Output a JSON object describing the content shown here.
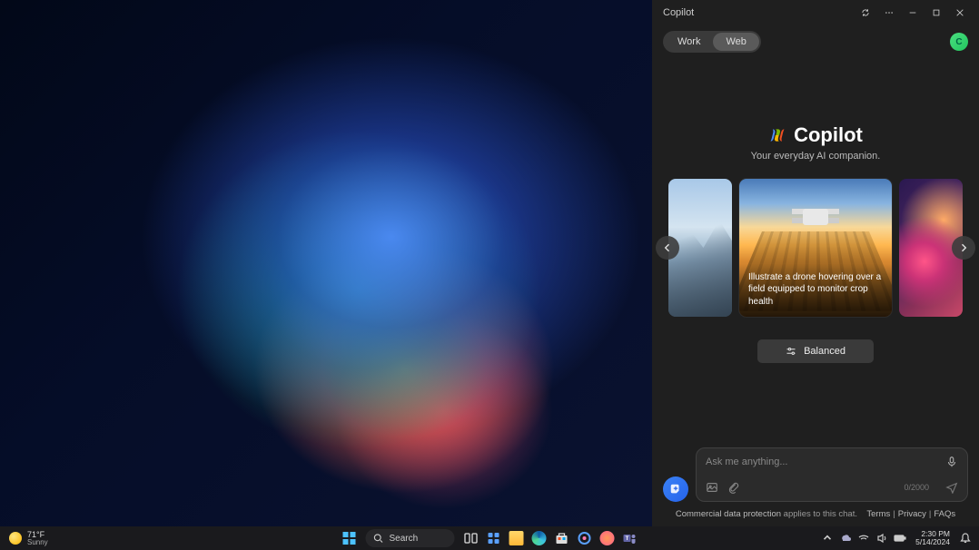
{
  "window": {
    "title": "Copilot"
  },
  "modes": {
    "work": "Work",
    "web": "Web",
    "active": "web"
  },
  "avatar_initial": "C",
  "hero": {
    "title": "Copilot",
    "subtitle": "Your everyday AI companion."
  },
  "carousel": {
    "main_caption": "Illustrate a drone hovering over a field equipped to monitor crop health"
  },
  "style_button": "Balanced",
  "chat": {
    "placeholder": "Ask me anything...",
    "char_count": "0/2000"
  },
  "footer": {
    "protection_link": "Commercial data protection",
    "protection_suffix": " applies to this chat.",
    "terms": "Terms",
    "privacy": "Privacy",
    "faqs": "FAQs"
  },
  "taskbar": {
    "weather_temp": "71°F",
    "weather_cond": "Sunny",
    "search_label": "Search",
    "time": "2:30 PM",
    "date": "5/14/2024"
  }
}
